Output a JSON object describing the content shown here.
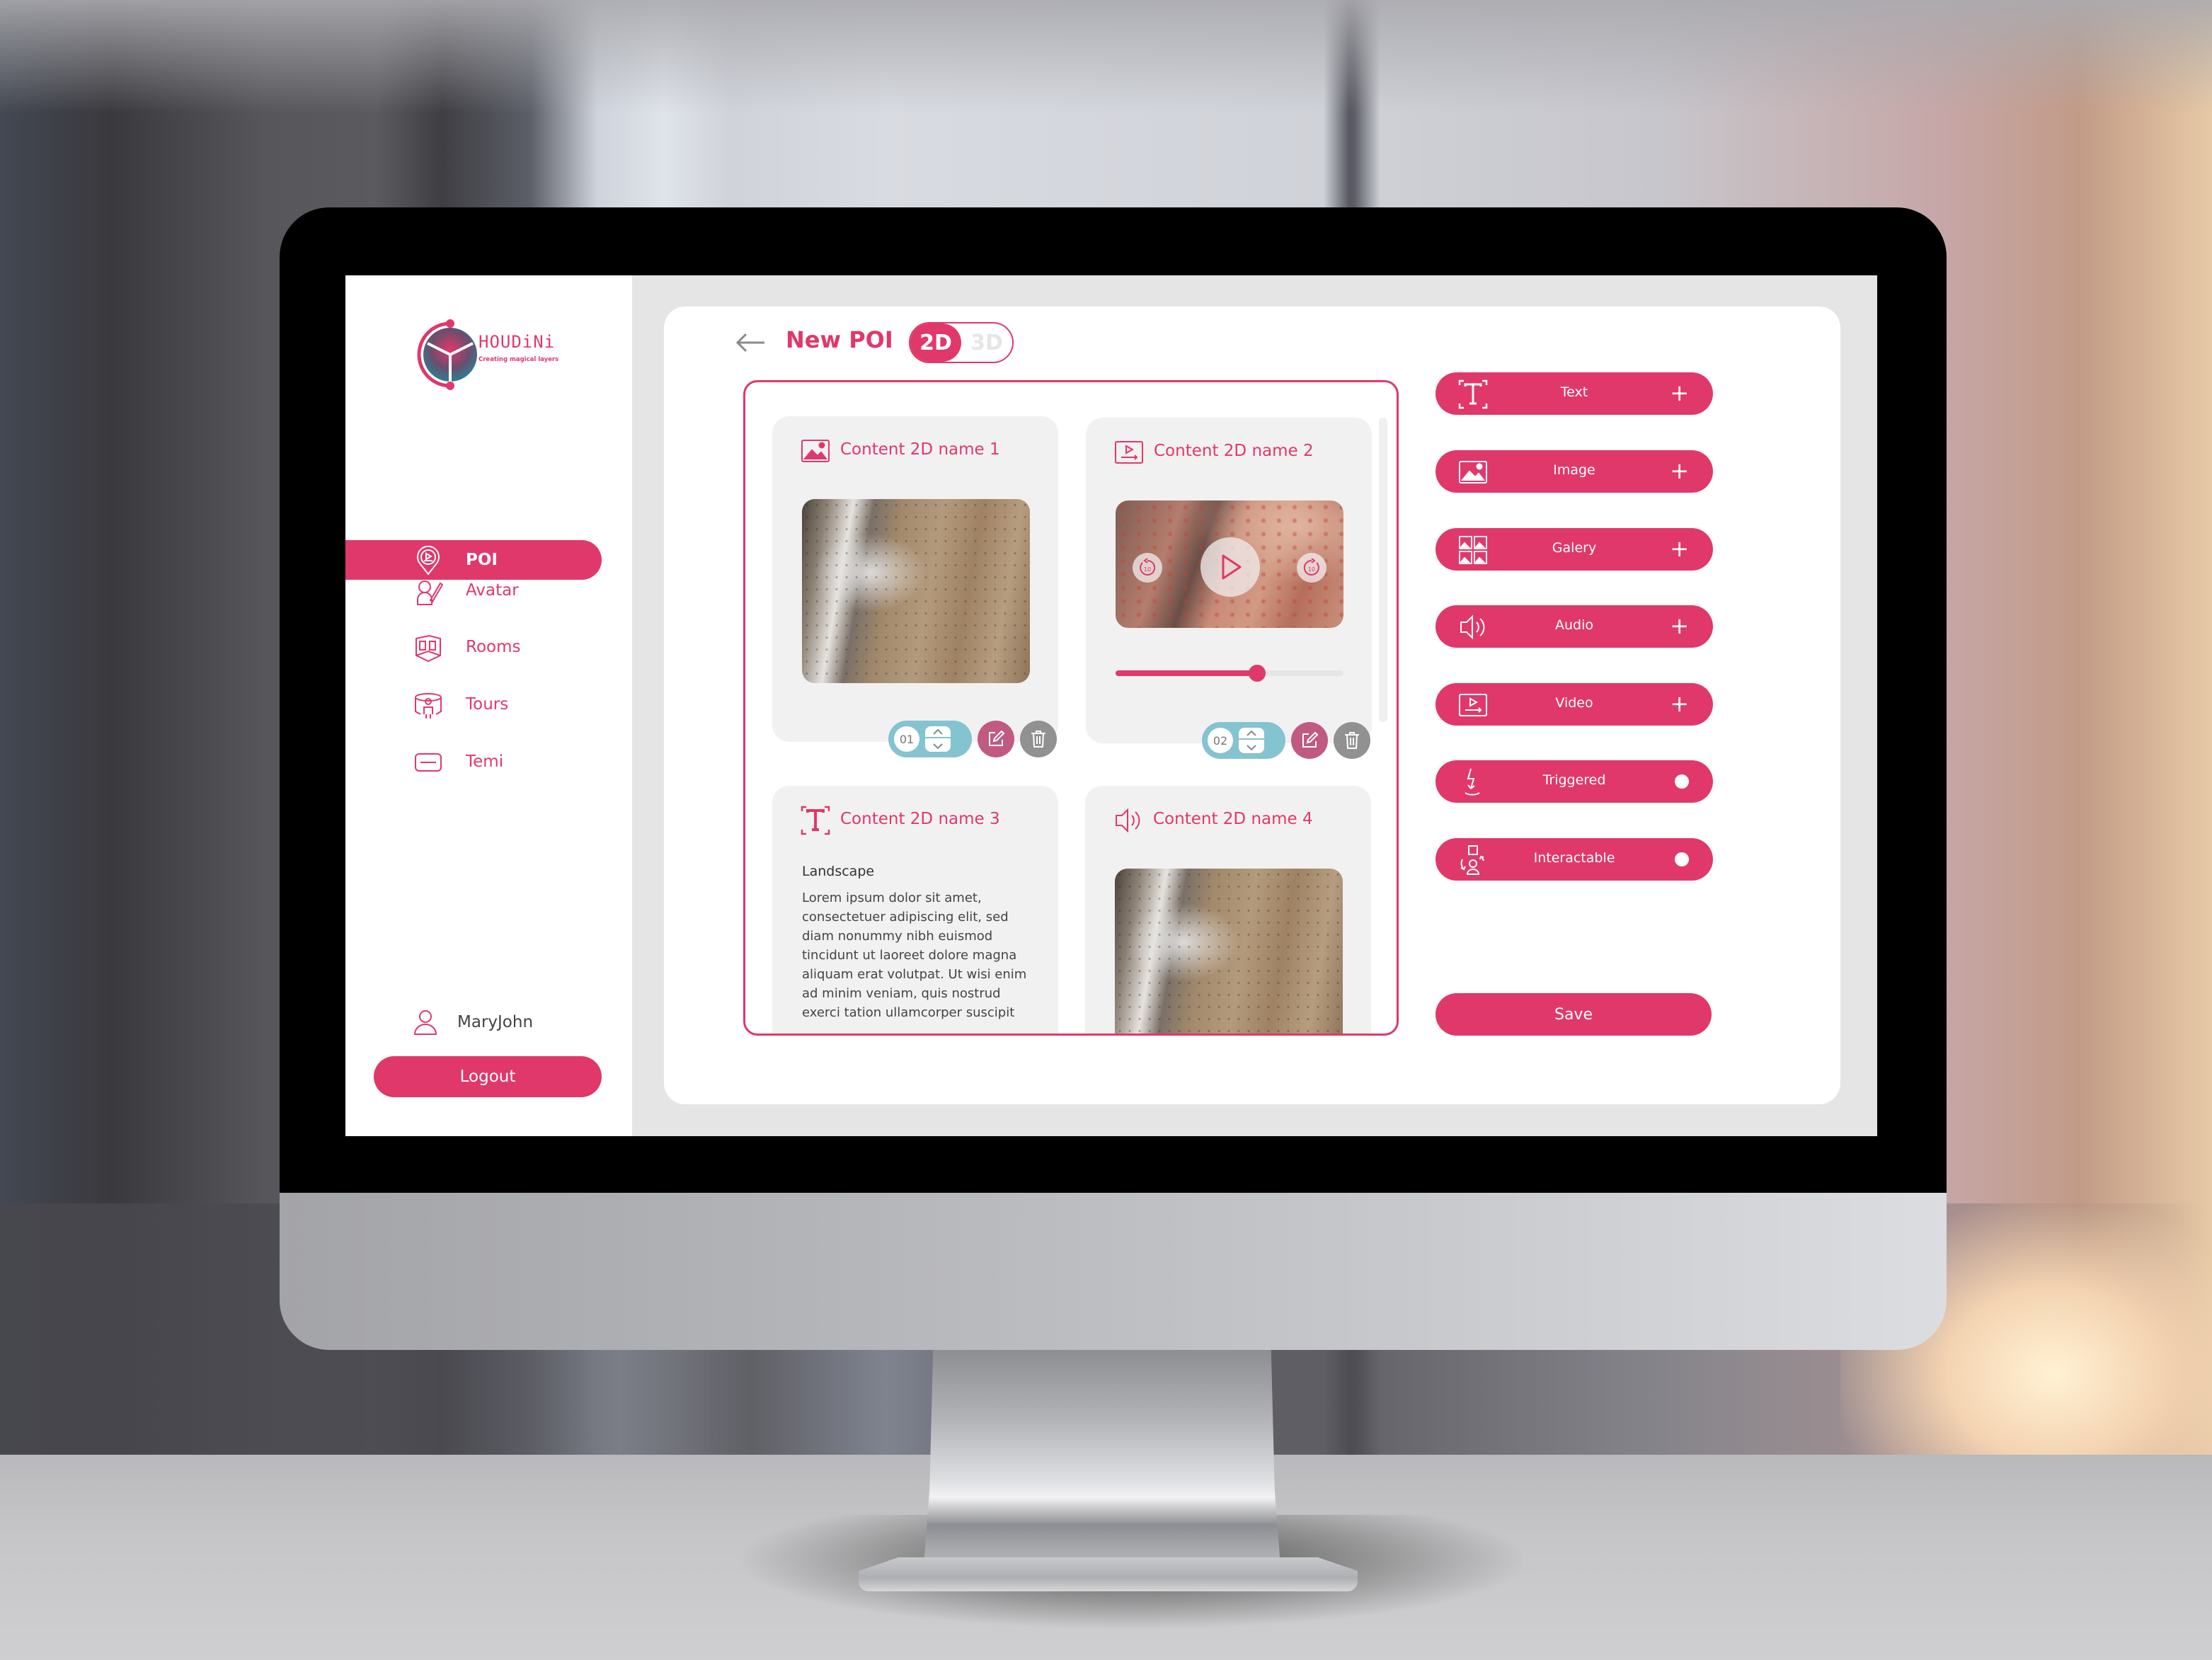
{
  "app": {
    "brand": "HOUDiNi",
    "tagline": "Creating magical layers"
  },
  "colors": {
    "accent": "#e0386a",
    "order_pill": "#84c3d0",
    "edit": "#c15a80",
    "delete": "#919191",
    "card_bg": "#f1f1f1",
    "main_bg": "#e5e5e5"
  },
  "sidebar": {
    "items": [
      {
        "label": "POI",
        "icon": "poi-pin-icon",
        "active": true
      },
      {
        "label": "Avatar",
        "icon": "avatar-edit-icon",
        "active": false
      },
      {
        "label": "Rooms",
        "icon": "rooms-icon",
        "active": false
      },
      {
        "label": "Tours",
        "icon": "tours-icon",
        "active": false
      },
      {
        "label": "Temi",
        "icon": "temi-icon",
        "active": false
      }
    ],
    "user": {
      "name": "MaryJohn",
      "icon": "user-icon"
    },
    "logout_label": "Logout"
  },
  "header": {
    "back_icon": "arrow-left-icon",
    "title": "New POI",
    "toggle": {
      "options": [
        "2D",
        "3D"
      ],
      "selected": "2D"
    }
  },
  "contents": [
    {
      "title": "Content 2D name 1",
      "type": "image",
      "icon": "image-icon",
      "order": "01"
    },
    {
      "title": "Content 2D name 2",
      "type": "video",
      "icon": "video-icon",
      "order": "02",
      "skip_back_label": "10",
      "skip_forward_label": "10",
      "progress": 0.62
    },
    {
      "title": "Content 2D name 3",
      "type": "text",
      "icon": "text-icon",
      "heading": "Landscape",
      "body": "Lorem ipsum dolor sit amet, consectetuer adipiscing elit, sed diam nonummy nibh euismod tincidunt ut laoreet dolore magna aliquam erat volutpat. Ut wisi enim ad minim veniam, quis nostrud exerci tation ullamcorper suscipit"
    },
    {
      "title": "Content 2D name 4",
      "type": "audio",
      "icon": "audio-icon"
    }
  ],
  "tools": [
    {
      "label": "Text",
      "icon": "text-icon",
      "action": "+"
    },
    {
      "label": "Image",
      "icon": "image-icon",
      "action": "+"
    },
    {
      "label": "Galery",
      "icon": "gallery-icon",
      "action": "+"
    },
    {
      "label": "Audio",
      "icon": "audio-icon",
      "action": "+"
    },
    {
      "label": "Video",
      "icon": "video-icon",
      "action": "+"
    },
    {
      "label": "Triggered",
      "icon": "trigger-icon",
      "action": "toggle"
    },
    {
      "label": "Interactable",
      "icon": "interact-icon",
      "action": "toggle"
    }
  ],
  "save_label": "Save"
}
